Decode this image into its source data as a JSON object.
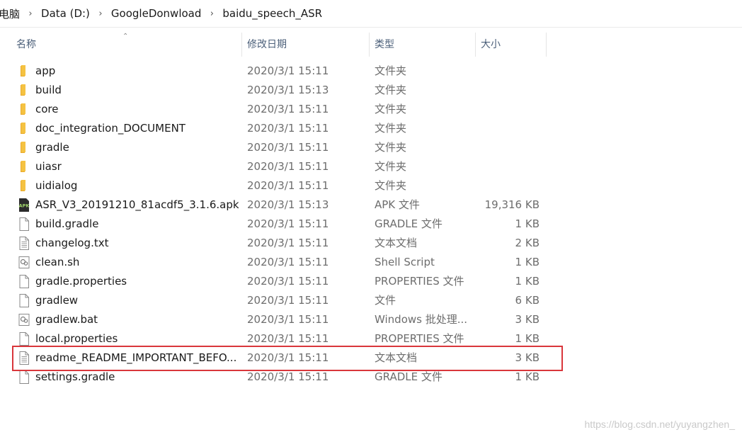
{
  "breadcrumb": [
    "电脑",
    "Data (D:)",
    "GoogleDonwload",
    "baidu_speech_ASR"
  ],
  "columns": {
    "name": "名称",
    "date": "修改日期",
    "type": "类型",
    "size": "大小"
  },
  "files": [
    {
      "name": "app",
      "date": "2020/3/1 15:11",
      "type": "文件夹",
      "size": "",
      "icon": "folder-icon"
    },
    {
      "name": "build",
      "date": "2020/3/1 15:13",
      "type": "文件夹",
      "size": "",
      "icon": "folder-icon"
    },
    {
      "name": "core",
      "date": "2020/3/1 15:11",
      "type": "文件夹",
      "size": "",
      "icon": "folder-icon"
    },
    {
      "name": "doc_integration_DOCUMENT",
      "date": "2020/3/1 15:11",
      "type": "文件夹",
      "size": "",
      "icon": "folder-icon"
    },
    {
      "name": "gradle",
      "date": "2020/3/1 15:11",
      "type": "文件夹",
      "size": "",
      "icon": "folder-icon"
    },
    {
      "name": "uiasr",
      "date": "2020/3/1 15:11",
      "type": "文件夹",
      "size": "",
      "icon": "folder-icon"
    },
    {
      "name": "uidialog",
      "date": "2020/3/1 15:11",
      "type": "文件夹",
      "size": "",
      "icon": "folder-icon"
    },
    {
      "name": "ASR_V3_20191210_81acdf5_3.1.6.apk",
      "date": "2020/3/1 15:13",
      "type": "APK 文件",
      "size": "19,316 KB",
      "icon": "apk-file-icon"
    },
    {
      "name": "build.gradle",
      "date": "2020/3/1 15:11",
      "type": "GRADLE 文件",
      "size": "1 KB",
      "icon": "blank-file-icon"
    },
    {
      "name": "changelog.txt",
      "date": "2020/3/1 15:11",
      "type": "文本文档",
      "size": "2 KB",
      "icon": "text-file-icon"
    },
    {
      "name": "clean.sh",
      "date": "2020/3/1 15:11",
      "type": "Shell Script",
      "size": "1 KB",
      "icon": "script-file-icon"
    },
    {
      "name": "gradle.properties",
      "date": "2020/3/1 15:11",
      "type": "PROPERTIES 文件",
      "size": "1 KB",
      "icon": "blank-file-icon"
    },
    {
      "name": "gradlew",
      "date": "2020/3/1 15:11",
      "type": "文件",
      "size": "6 KB",
      "icon": "blank-file-icon"
    },
    {
      "name": "gradlew.bat",
      "date": "2020/3/1 15:11",
      "type": "Windows 批处理...",
      "size": "3 KB",
      "icon": "script-file-icon"
    },
    {
      "name": "local.properties",
      "date": "2020/3/1 15:11",
      "type": "PROPERTIES 文件",
      "size": "1 KB",
      "icon": "blank-file-icon"
    },
    {
      "name": "readme_README_IMPORTANT_BEFO...",
      "date": "2020/3/1 15:11",
      "type": "文本文档",
      "size": "3 KB",
      "icon": "text-file-icon"
    },
    {
      "name": "settings.gradle",
      "date": "2020/3/1 15:11",
      "type": "GRADLE 文件",
      "size": "1 KB",
      "icon": "blank-file-icon"
    }
  ],
  "highlighted_row": "readme_README_IMPORTANT_BEFO...",
  "colors": {
    "folder": "#f5c242",
    "highlight": "#d9363b",
    "header_text": "#4c607a"
  },
  "watermark": "https://blog.csdn.net/yuyangzhen_"
}
